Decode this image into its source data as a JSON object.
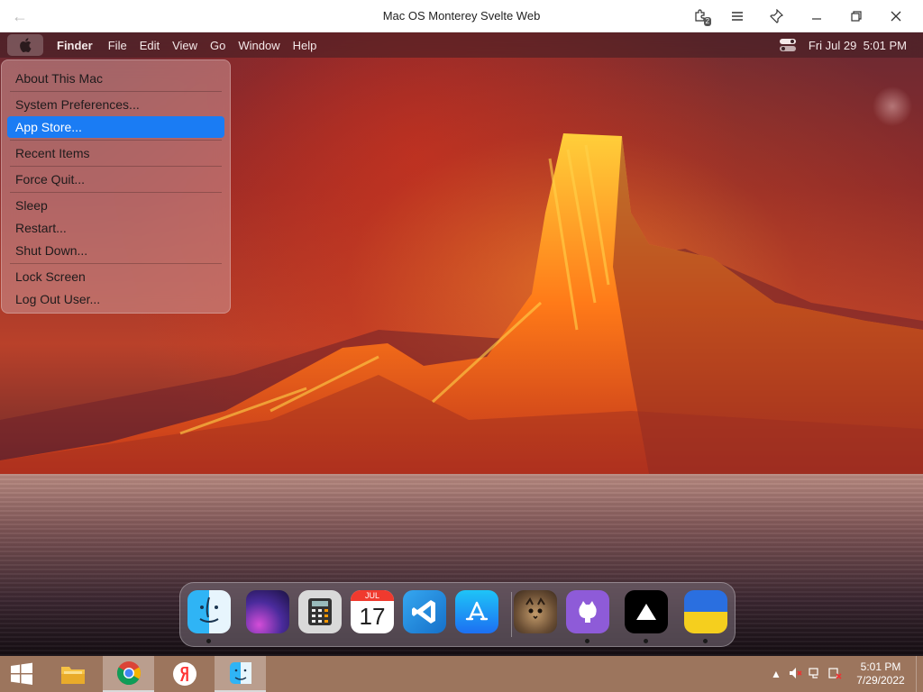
{
  "window": {
    "title": "Mac OS Monterey Svelte Web",
    "back_icon": "arrow-left-icon",
    "extensions_badge": "2"
  },
  "menubar": {
    "app_name": "Finder",
    "menus": [
      "File",
      "Edit",
      "View",
      "Go",
      "Window",
      "Help"
    ],
    "datetime": "Fri Jul 29  5:01 PM"
  },
  "apple_menu": {
    "groups": [
      [
        "About This Mac"
      ],
      [
        "System Preferences...",
        "App Store..."
      ],
      [
        "Recent Items"
      ],
      [
        "Force Quit..."
      ],
      [
        "Sleep",
        "Restart...",
        "Shut Down..."
      ],
      [
        "Lock Screen",
        "Log Out User..."
      ]
    ],
    "highlighted": "App Store..."
  },
  "dock": {
    "apps": [
      {
        "name": "Finder",
        "running": true
      },
      {
        "name": "Monterey wallpaper",
        "running": false
      },
      {
        "name": "Calculator",
        "running": false
      },
      {
        "name": "Calendar",
        "running": false,
        "month": "JUL",
        "day": "17"
      },
      {
        "name": "Visual Studio Code",
        "running": false
      },
      {
        "name": "App Store",
        "running": false
      },
      {
        "name": "Cat app",
        "running": false
      },
      {
        "name": "GitHub",
        "running": true
      },
      {
        "name": "Vercel",
        "running": true
      },
      {
        "name": "Ukraine",
        "running": true
      }
    ]
  },
  "taskbar": {
    "apps": [
      "Start",
      "File Explorer",
      "Google Chrome",
      "Yandex Browser",
      "Finder"
    ],
    "active": "Google Chrome",
    "time": "5:01 PM",
    "date": "7/29/2022"
  },
  "colors": {
    "highlight": "#1a7cf4",
    "taskbar": "#9c755d"
  }
}
